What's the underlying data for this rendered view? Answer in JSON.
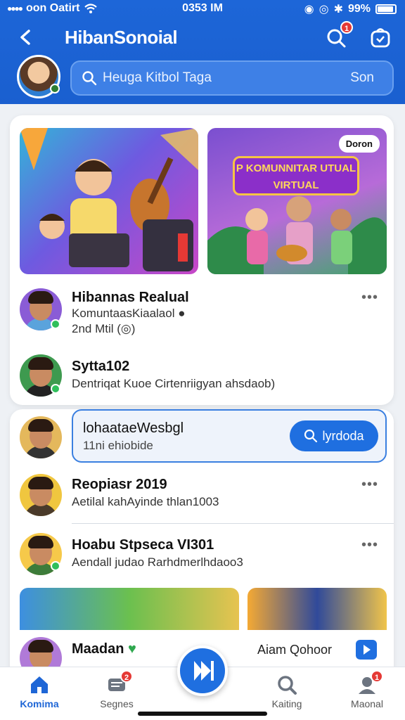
{
  "status": {
    "carrier": "oon Oatirt",
    "time": "0353 IM",
    "battery": "99%"
  },
  "header": {
    "title": "HibanSonoial",
    "notif_badge": "1",
    "search": {
      "placeholder": "Heuga Kitbol Taga",
      "action": "Son"
    }
  },
  "feed": {
    "media2_pill": "Doron",
    "media2_banner": "P KOMUNNITAR UTUAL VIRTUAL",
    "posts": [
      {
        "name": "Hibannas Realual",
        "line1": "KomuntaasKiaalaol ●",
        "line2": "2nd Mtil (◎)"
      },
      {
        "name": "Sytta102",
        "line1": "Dentriqat Kuoe Cirtenriigyan ahsdaob)"
      }
    ]
  },
  "list": {
    "highlight": {
      "title": "lohaataeWesbgl",
      "sub": "11ni ehiobide",
      "button": "lyrdoda"
    },
    "items": [
      {
        "name": "Reopiasr 2019",
        "sub": "Aetilal kahAyinde thlan1003"
      },
      {
        "name": "Hoabu Stpseca VI301",
        "sub": "Aendall judao Rarhdmerlhdaoo3"
      },
      {
        "name": "Maadan",
        "sub": "",
        "right": "Aiam Qohoor"
      }
    ]
  },
  "nav": {
    "items": [
      {
        "label": "Komima"
      },
      {
        "label": "Segnes",
        "badge": "2"
      },
      {
        "label": "Kaiting"
      },
      {
        "label": "Maonal",
        "badge": "1"
      }
    ]
  },
  "colors": {
    "primary": "#1f6fe0",
    "header": "#1d66d8",
    "badge": "#e53935"
  }
}
